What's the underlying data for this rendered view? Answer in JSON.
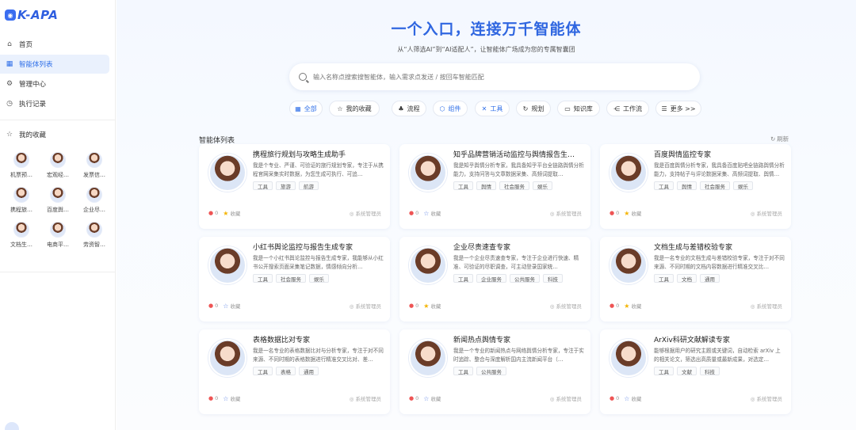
{
  "app": {
    "logo_text": "K-APA",
    "logo_icon": "robot-logo-icon"
  },
  "nav": {
    "items": [
      {
        "label": "首页",
        "icon": "home-icon",
        "active": false
      },
      {
        "label": "智能体列表",
        "icon": "grid-icon",
        "active": true
      },
      {
        "label": "管理中心",
        "icon": "settings-icon",
        "active": false
      },
      {
        "label": "执行记录",
        "icon": "clock-icon",
        "active": false
      }
    ]
  },
  "favorites": {
    "title": "我的收藏",
    "items": [
      "机票预…",
      "宏观经…",
      "发票信…",
      "携程旅…",
      "百度舆…",
      "企业尽…",
      "文档生…",
      "电商平…",
      "劳资智…"
    ]
  },
  "hero": {
    "title": "一个入口，连接万千智能体",
    "subtitle": "从“人筛选AI”到“AI适配人”，让智能体广场成为您的专属智囊团"
  },
  "search": {
    "placeholder": "输入名称点搜索搜智能体，输入需求点发送 / 按回车智能匹配"
  },
  "filters": [
    {
      "label": "全部",
      "icon": "grid-icon",
      "active": true
    },
    {
      "label": "我的收藏",
      "icon": "star-icon",
      "active": false
    },
    {
      "label": "流程",
      "icon": "flow-icon",
      "active": false
    },
    {
      "label": "组件",
      "icon": "component-icon",
      "active": true
    },
    {
      "label": "工具",
      "icon": "tool-icon",
      "active": true
    },
    {
      "label": "规划",
      "icon": "plan-icon",
      "active": false
    },
    {
      "label": "知识库",
      "icon": "book-icon",
      "active": false
    },
    {
      "label": "工作流",
      "icon": "workflow-icon",
      "active": false
    },
    {
      "label": "更多 >>",
      "icon": "list-icon",
      "active": false
    }
  ],
  "list": {
    "title": "智能体列表",
    "refresh": "刷新",
    "fav_label": "收藏",
    "owner": "系统管理员"
  },
  "agents": [
    {
      "title": "携程旅行规划与攻略生成助手",
      "desc": "我是个专业、严谨、可验证的旅行规划专家，专注于从携程官网采集实时数据，为您生成可执行、可追…",
      "tags": [
        "工具",
        "旅游",
        "航游"
      ],
      "likes": "0",
      "starred": true
    },
    {
      "title": "知乎品牌营销活动监控与舆情报告生…",
      "desc": "我是知乎舆情分析专家，我具备知乎平台全链路舆情分析能力，支持问答与文章数据采集、高频词提取…",
      "tags": [
        "工具",
        "舆情",
        "社会服务",
        "娱乐"
      ],
      "likes": "0",
      "starred": false
    },
    {
      "title": "百度舆情监控专家",
      "desc": "我是百度舆情分析专家，我具备百度贴吧全链路舆情分析能力，支持帖子与评论数据采集、高频词提取、舆情…",
      "tags": [
        "工具",
        "舆情",
        "社会服务",
        "娱乐"
      ],
      "likes": "0",
      "starred": true
    },
    {
      "title": "小红书舆论监控与报告生成专家",
      "desc": "我是一个小红书舆论监控与报告生成专家，我能够从小红书公开搜索页面采集笔记数据，情感倾向分析…",
      "tags": [
        "工具",
        "社会服务",
        "娱乐"
      ],
      "likes": "0",
      "starred": false
    },
    {
      "title": "企业尽责速查专家",
      "desc": "我是一个企业尽责速查专家，专注于企业进行快速、精准、可验证的尽职调查，可主动登录国家统…",
      "tags": [
        "工具",
        "企业服务",
        "公共服务",
        "科技"
      ],
      "likes": "0",
      "starred": true
    },
    {
      "title": "文档生成与差错校验专家",
      "desc": "我是一名专业的文档生成与差错校验专家，专注于对不同来源、不同时期的文档内容数据进行精准交叉比…",
      "tags": [
        "工具",
        "文档",
        "通用"
      ],
      "likes": "0",
      "starred": true
    },
    {
      "title": "表格数据比对专家",
      "desc": "我是一名专业的表格数据比对与分析专家，专注于对不同来源、不同时期的表格数据进行精准交叉比对、差…",
      "tags": [
        "工具",
        "表格",
        "通用"
      ],
      "likes": "0",
      "starred": false
    },
    {
      "title": "新闻热点舆情专家",
      "desc": "我是一个专业的新闻热点与网络舆情分析专家，专注于实时追踪、整合与深度解析国内主流新闻平台（…",
      "tags": [
        "工具",
        "公共服务"
      ],
      "likes": "0",
      "starred": false
    },
    {
      "title": "ArXiv科研文献解读专家",
      "desc": "能够根据用户的研究主题或关键词，自动检索 arXiv 上的相关论文，筛选出高质量或最新成果，对选定…",
      "tags": [
        "工具",
        "文献",
        "科技"
      ],
      "likes": "0",
      "starred": false
    }
  ]
}
